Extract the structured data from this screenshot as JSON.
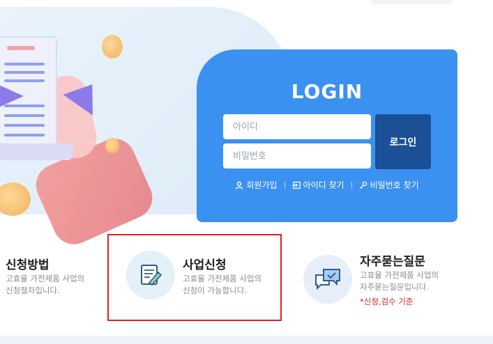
{
  "login": {
    "title": "LOGIN",
    "id_placeholder": "아이디",
    "pw_placeholder": "비밀번호",
    "login_button": "로그인",
    "links": [
      {
        "label": "회원가입",
        "icon": "user-icon"
      },
      {
        "label": "아이디 찾기",
        "icon": "login-arrow-icon"
      },
      {
        "label": "비밀번호 찾기",
        "icon": "key-icon"
      }
    ]
  },
  "features": [
    {
      "title": "신청방법",
      "desc_line1": "고효율 가전제품 사업의",
      "desc_line2": "신청절차입니다."
    },
    {
      "title": "사업신청",
      "desc_line1": "고효율 가전제품 사업의",
      "desc_line2": "신청이 가능합니다.",
      "icon": "document-edit-icon"
    },
    {
      "title": "자주묻는질문",
      "desc_line1": "고효율 가전제품 사업의",
      "desc_line2": "자주묻는질문입니다.",
      "note": "*신청,검수 기준",
      "icon": "chat-check-icon"
    }
  ],
  "colors": {
    "login_bg": "#3b91f0",
    "login_button": "#1b4f96",
    "highlight": "#e02020"
  }
}
